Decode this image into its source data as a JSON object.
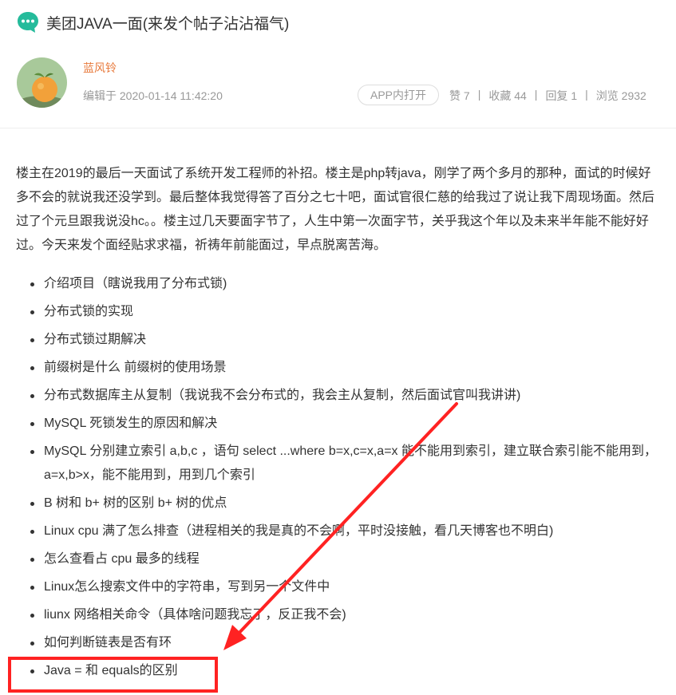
{
  "post": {
    "title": "美团JAVA一面(来发个帖子沾沾福气)",
    "author": "蓝风铃",
    "edit_time": "编辑于 2020-01-14 11:42:20",
    "open_in_app": "APP内打开",
    "stats": [
      {
        "label": "赞",
        "value": "7"
      },
      {
        "label": "收藏",
        "value": "44"
      },
      {
        "label": "回复",
        "value": "1"
      },
      {
        "label": "浏览",
        "value": "2932"
      }
    ]
  },
  "content": {
    "intro": "楼主在2019的最后一天面试了系统开发工程师的补招。楼主是php转java，刚学了两个多月的那种，面试的时候好多不会的就说我还没学到。最后整体我觉得答了百分之七十吧，面试官很仁慈的给我过了说让我下周现场面。然后过了个元旦跟我说没hc。。楼主过几天要面字节了，人生中第一次面字节，关乎我这个年以及未来半年能不能好好过。今天来发个面经贴求求福，祈祷年前能面过，早点脱离苦海。",
    "questions": [
      "介绍项目（瞎说我用了分布式锁)",
      "分布式锁的实现",
      "分布式锁过期解决",
      "前缀树是什么 前缀树的使用场景",
      "分布式数据库主从复制（我说我不会分布式的，我会主从复制，然后面试官叫我讲讲)",
      "MySQL 死锁发生的原因和解决",
      "MySQL 分别建立索引 a,b,c ，语句 select ...where b=x,c=x,a=x 能不能用到索引，建立联合索引能不能用到，a=x,b>x，能不能用到，用到几个索引",
      "B 树和 b+ 树的区别 b+ 树的优点",
      "Linux cpu 满了怎么排查（进程相关的我是真的不会啊，平时没接触，看几天博客也不明白)",
      "怎么查看占 cpu 最多的线程",
      "Linux怎么搜索文件中的字符串，写到另一个文件中",
      "liunx 网络相关命令（具体啥问题我忘了，反正我不会)",
      "如何判断链表是否有环",
      "Java = 和 equals的区别"
    ]
  },
  "colors": {
    "accent": "#e87a3c",
    "icon_green": "#25bb9b",
    "annotation_red": "#ff2222"
  }
}
